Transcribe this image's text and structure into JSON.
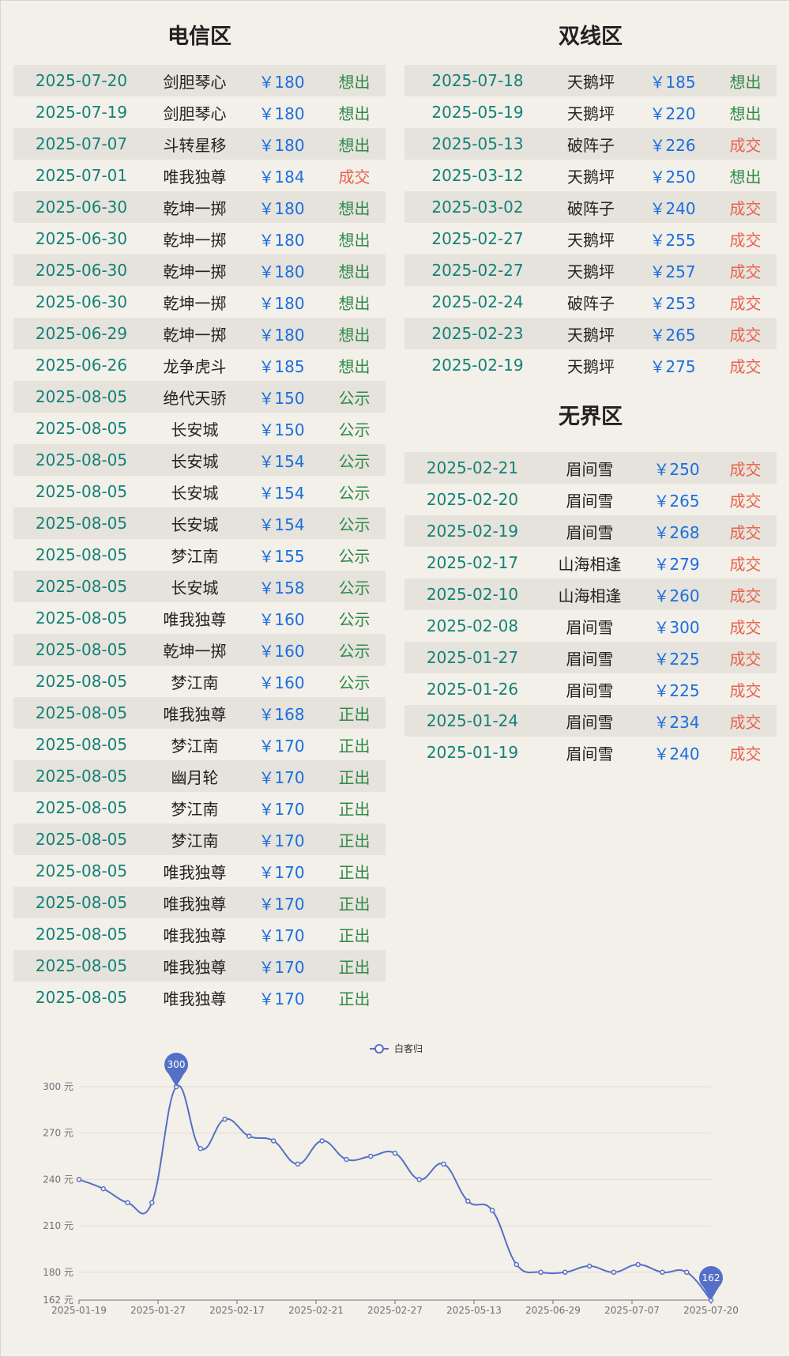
{
  "sections": {
    "telecom": {
      "title": "电信区",
      "rows": [
        [
          "2025-07-20",
          "剑胆琴心",
          "￥180",
          "想出"
        ],
        [
          "2025-07-19",
          "剑胆琴心",
          "￥180",
          "想出"
        ],
        [
          "2025-07-07",
          "斗转星移",
          "￥180",
          "想出"
        ],
        [
          "2025-07-01",
          "唯我独尊",
          "￥184",
          "成交"
        ],
        [
          "2025-06-30",
          "乾坤一掷",
          "￥180",
          "想出"
        ],
        [
          "2025-06-30",
          "乾坤一掷",
          "￥180",
          "想出"
        ],
        [
          "2025-06-30",
          "乾坤一掷",
          "￥180",
          "想出"
        ],
        [
          "2025-06-30",
          "乾坤一掷",
          "￥180",
          "想出"
        ],
        [
          "2025-06-29",
          "乾坤一掷",
          "￥180",
          "想出"
        ],
        [
          "2025-06-26",
          "龙争虎斗",
          "￥185",
          "想出"
        ],
        [
          "2025-08-05",
          "绝代天骄",
          "￥150",
          "公示"
        ],
        [
          "2025-08-05",
          "长安城",
          "￥150",
          "公示"
        ],
        [
          "2025-08-05",
          "长安城",
          "￥154",
          "公示"
        ],
        [
          "2025-08-05",
          "长安城",
          "￥154",
          "公示"
        ],
        [
          "2025-08-05",
          "长安城",
          "￥154",
          "公示"
        ],
        [
          "2025-08-05",
          "梦江南",
          "￥155",
          "公示"
        ],
        [
          "2025-08-05",
          "长安城",
          "￥158",
          "公示"
        ],
        [
          "2025-08-05",
          "唯我独尊",
          "￥160",
          "公示"
        ],
        [
          "2025-08-05",
          "乾坤一掷",
          "￥160",
          "公示"
        ],
        [
          "2025-08-05",
          "梦江南",
          "￥160",
          "公示"
        ],
        [
          "2025-08-05",
          "唯我独尊",
          "￥168",
          "正出"
        ],
        [
          "2025-08-05",
          "梦江南",
          "￥170",
          "正出"
        ],
        [
          "2025-08-05",
          "幽月轮",
          "￥170",
          "正出"
        ],
        [
          "2025-08-05",
          "梦江南",
          "￥170",
          "正出"
        ],
        [
          "2025-08-05",
          "梦江南",
          "￥170",
          "正出"
        ],
        [
          "2025-08-05",
          "唯我独尊",
          "￥170",
          "正出"
        ],
        [
          "2025-08-05",
          "唯我独尊",
          "￥170",
          "正出"
        ],
        [
          "2025-08-05",
          "唯我独尊",
          "￥170",
          "正出"
        ],
        [
          "2025-08-05",
          "唯我独尊",
          "￥170",
          "正出"
        ],
        [
          "2025-08-05",
          "唯我独尊",
          "￥170",
          "正出"
        ]
      ]
    },
    "dual": {
      "title": "双线区",
      "rows": [
        [
          "2025-07-18",
          "天鹅坪",
          "￥185",
          "想出"
        ],
        [
          "2025-05-19",
          "天鹅坪",
          "￥220",
          "想出"
        ],
        [
          "2025-05-13",
          "破阵子",
          "￥226",
          "成交"
        ],
        [
          "2025-03-12",
          "天鹅坪",
          "￥250",
          "想出"
        ],
        [
          "2025-03-02",
          "破阵子",
          "￥240",
          "成交"
        ],
        [
          "2025-02-27",
          "天鹅坪",
          "￥255",
          "成交"
        ],
        [
          "2025-02-27",
          "天鹅坪",
          "￥257",
          "成交"
        ],
        [
          "2025-02-24",
          "破阵子",
          "￥253",
          "成交"
        ],
        [
          "2025-02-23",
          "天鹅坪",
          "￥265",
          "成交"
        ],
        [
          "2025-02-19",
          "天鹅坪",
          "￥275",
          "成交"
        ]
      ]
    },
    "boundless": {
      "title": "无界区",
      "rows": [
        [
          "2025-02-21",
          "眉间雪",
          "￥250",
          "成交"
        ],
        [
          "2025-02-20",
          "眉间雪",
          "￥265",
          "成交"
        ],
        [
          "2025-02-19",
          "眉间雪",
          "￥268",
          "成交"
        ],
        [
          "2025-02-17",
          "山海相逢",
          "￥279",
          "成交"
        ],
        [
          "2025-02-10",
          "山海相逢",
          "￥260",
          "成交"
        ],
        [
          "2025-02-08",
          "眉间雪",
          "￥300",
          "成交"
        ],
        [
          "2025-01-27",
          "眉间雪",
          "￥225",
          "成交"
        ],
        [
          "2025-01-26",
          "眉间雪",
          "￥225",
          "成交"
        ],
        [
          "2025-01-24",
          "眉间雪",
          "￥234",
          "成交"
        ],
        [
          "2025-01-19",
          "眉间雪",
          "￥240",
          "成交"
        ]
      ]
    }
  },
  "colors": {
    "date": "#138277",
    "price": "#1a6fe0",
    "sell": "#2f8a49",
    "deal": "#e8624b",
    "series": "#5470c6"
  },
  "chart_data": {
    "type": "line",
    "legend": "白客归",
    "legend_position": "top-center",
    "x": [
      "2025-01-19",
      "2025-01-24",
      "2025-01-26",
      "2025-01-27",
      "2025-02-08",
      "2025-02-10",
      "2025-02-17",
      "2025-02-19",
      "2025-02-20",
      "2025-02-21",
      "2025-02-23",
      "2025-02-24",
      "2025-02-27",
      "2025-02-27",
      "2025-03-02",
      "2025-03-12",
      "2025-05-13",
      "2025-05-19",
      "2025-06-26",
      "2025-06-29",
      "2025-06-30",
      "2025-07-01",
      "2025-07-07",
      "2025-07-18",
      "2025-07-19",
      "2025-07-20",
      "2025-08-05"
    ],
    "x_tick_labels": [
      "2025-01-19",
      "2025-01-27",
      "2025-02-17",
      "2025-02-21",
      "2025-02-27",
      "2025-05-13",
      "2025-06-29",
      "2025-07-07",
      "2025-07-20"
    ],
    "series": [
      {
        "name": "白客归",
        "values": [
          240,
          234,
          225,
          225,
          300,
          260,
          279,
          268,
          265,
          250,
          265,
          253,
          255,
          257,
          240,
          250,
          226,
          220,
          185,
          180,
          180,
          184,
          180,
          185,
          180,
          180,
          162
        ]
      }
    ],
    "y_ticks": [
      "162 元",
      "180 元",
      "210 元",
      "240 元",
      "270 元",
      "300 元"
    ],
    "ylim": [
      162,
      300
    ],
    "max_marker": "300",
    "min_marker": "162",
    "grid": true
  }
}
